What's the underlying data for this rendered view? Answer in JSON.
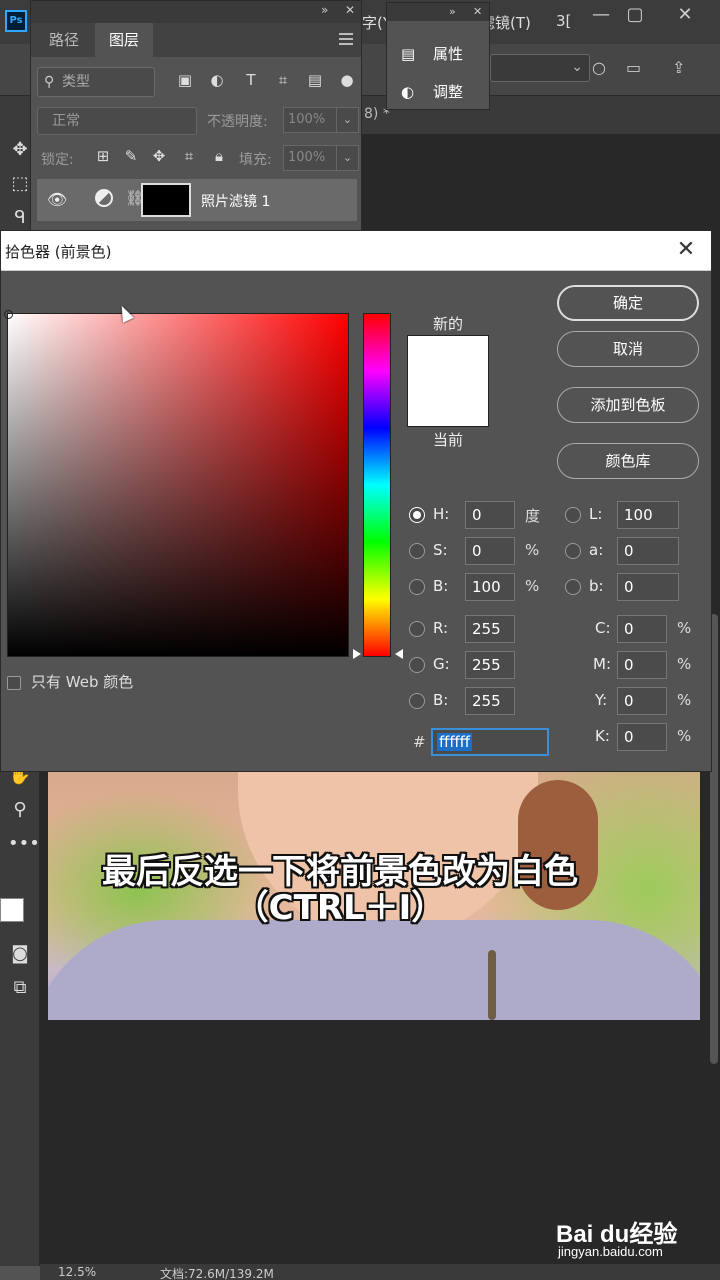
{
  "app": {
    "logo": "Ps",
    "menu_fragments": [
      "字(Y",
      "滤镜(T)",
      "3[",
      "3"
    ]
  },
  "document": {
    "tab_fragment": "8) *"
  },
  "layers_panel": {
    "tabs": [
      "路径",
      "图层"
    ],
    "filter_placeholder": "类型",
    "blend_mode": "正常",
    "opacity_label": "不透明度:",
    "opacity_value": "100%",
    "lock_label": "锁定:",
    "fill_label": "填充:",
    "fill_value": "100%",
    "layer_name": "照片滤镜 1"
  },
  "properties_panel": {
    "items": [
      "属性",
      "调整"
    ]
  },
  "color_picker": {
    "title": "拾色器 (前景色)",
    "new_label": "新的",
    "current_label": "当前",
    "new_color": "#ffffff",
    "current_color": "#ffffff",
    "buttons": {
      "ok": "确定",
      "cancel": "取消",
      "add_swatch": "添加到色板",
      "color_libraries": "颜色库"
    },
    "web_only_label": "只有 Web 颜色",
    "fields": {
      "H": {
        "label": "H:",
        "value": "0",
        "unit": "度"
      },
      "S": {
        "label": "S:",
        "value": "0",
        "unit": "%"
      },
      "Bv": {
        "label": "B:",
        "value": "100",
        "unit": "%"
      },
      "R": {
        "label": "R:",
        "value": "255"
      },
      "G": {
        "label": "G:",
        "value": "255"
      },
      "Bl": {
        "label": "B:",
        "value": "255"
      },
      "L": {
        "label": "L:",
        "value": "100"
      },
      "a": {
        "label": "a:",
        "value": "0"
      },
      "b": {
        "label": "b:",
        "value": "0"
      },
      "C": {
        "label": "C:",
        "value": "0",
        "unit": "%"
      },
      "M": {
        "label": "M:",
        "value": "0",
        "unit": "%"
      },
      "Y": {
        "label": "Y:",
        "value": "0",
        "unit": "%"
      },
      "K": {
        "label": "K:",
        "value": "0",
        "unit": "%"
      }
    },
    "hex_label": "#",
    "hex_value": "ffffff"
  },
  "caption": {
    "line1": "最后反选一下将前景色改为白色",
    "line2": "（CTRL＋I）"
  },
  "status_bar": {
    "zoom": "12.5%",
    "doc_info": "文档:72.6M/139.2M"
  },
  "watermark": {
    "logo": "Bai du经验",
    "url": "jingyan.baidu.com"
  }
}
